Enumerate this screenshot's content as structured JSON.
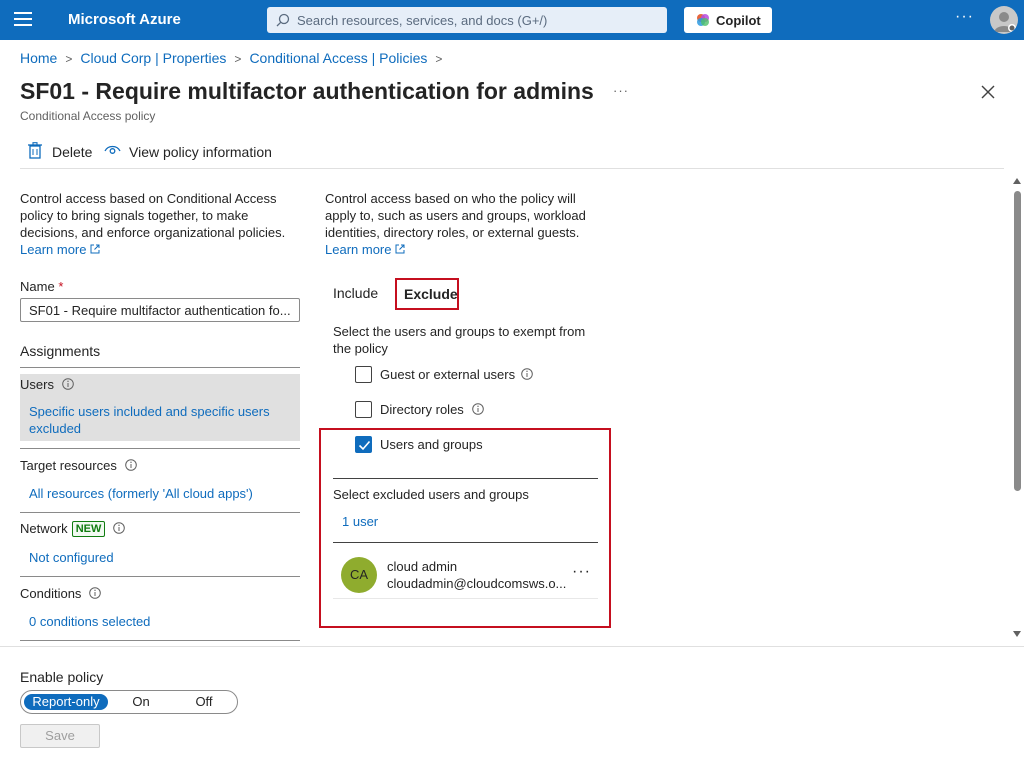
{
  "app": {
    "brand": "Microsoft Azure"
  },
  "search": {
    "placeholder": "Search resources, services, and docs (G+/)"
  },
  "header": {
    "copilot_label": "Copilot",
    "more": "···"
  },
  "breadcrumb": [
    {
      "label": "Home"
    },
    {
      "label": "Cloud Corp | Properties"
    },
    {
      "label": "Conditional Access | Policies"
    }
  ],
  "page": {
    "title": "SF01 - Require multifactor authentication for admins",
    "subtitle": "Conditional Access policy",
    "title_more": "···"
  },
  "toolbar": {
    "delete_label": "Delete",
    "view_info_label": "View policy information"
  },
  "left": {
    "description": "Control access based on Conditional Access policy to bring signals together, to make decisions, and enforce organizational policies.",
    "learn_more": "Learn more",
    "name_label": "Name",
    "name_required": "*",
    "name_value": "SF01 - Require multifactor authentication fo...",
    "assignments_heading": "Assignments",
    "users_title": "Users",
    "users_value": "Specific users included and specific users excluded",
    "target_title": "Target resources",
    "target_value": "All resources (formerly 'All cloud apps')",
    "network_title": "Network",
    "network_badge": "NEW",
    "network_value": "Not configured",
    "conditions_title": "Conditions",
    "conditions_value": "0 conditions selected"
  },
  "right": {
    "description": "Control access based on who the policy will apply to, such as users and groups, workload identities, directory roles, or external guests.",
    "learn_more": "Learn more",
    "tabs": [
      {
        "label": "Include"
      },
      {
        "label": "Exclude",
        "active": true
      }
    ],
    "select_desc": "Select the users and groups to exempt from the policy",
    "options": [
      {
        "label": "Guest or external users",
        "checked": false
      },
      {
        "label": "Directory roles",
        "checked": false
      },
      {
        "label": "Users and groups",
        "checked": true
      }
    ],
    "excluded_label": "Select excluded users and groups",
    "excluded_count": "1 user",
    "user": {
      "initials": "CA",
      "name": "cloud admin",
      "email": "cloudadmin@cloudcomsws.o...",
      "more": "···"
    }
  },
  "footer": {
    "enable_label": "Enable policy",
    "options": [
      {
        "label": "Report-only",
        "active": true
      },
      {
        "label": "On"
      },
      {
        "label": "Off"
      }
    ],
    "save_label": "Save"
  },
  "colors": {
    "accent": "#0f6cbd",
    "highlight": "#c50f1f",
    "avatar": "#8fac2e",
    "new_badge": "#107c10"
  }
}
